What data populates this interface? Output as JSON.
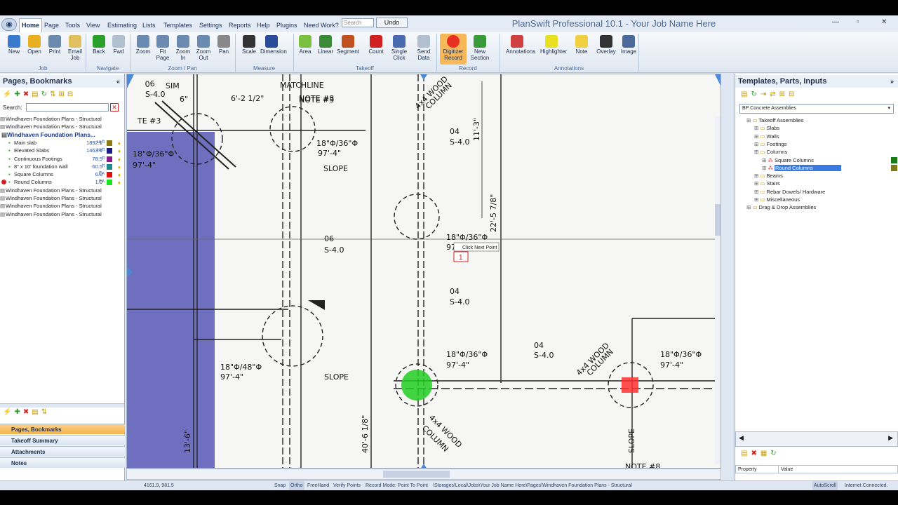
{
  "window": {
    "title": "PlanSwift Professional 10.1 - Your Job Name Here"
  },
  "menu": [
    "Home",
    "Page",
    "Tools",
    "View",
    "Estimating",
    "Lists",
    "Templates",
    "Settings",
    "Reports",
    "Help",
    "Plugins",
    "Need Work?"
  ],
  "search_placeholder": "Search",
  "undo_label": "Undo",
  "ribbon": {
    "buttons": [
      {
        "label": "New",
        "icon": "new-icon"
      },
      {
        "label": "Open",
        "icon": "open-folder-icon"
      },
      {
        "label": "Print",
        "icon": "printer-icon"
      },
      {
        "label": "Email\nJob",
        "icon": "email-icon"
      },
      {
        "label": "Back",
        "icon": "back-arrow-icon"
      },
      {
        "label": "Fwd",
        "icon": "forward-arrow-icon"
      },
      {
        "label": "Zoom",
        "icon": "zoom-icon"
      },
      {
        "label": "Fit\nPage",
        "icon": "fit-page-icon"
      },
      {
        "label": "Zoom\nIn",
        "icon": "zoom-in-icon"
      },
      {
        "label": "Zoom\nOut",
        "icon": "zoom-out-icon"
      },
      {
        "label": "Pan",
        "icon": "hand-icon"
      },
      {
        "label": "Scale",
        "icon": "scale-icon"
      },
      {
        "label": "Dimension",
        "icon": "dimension-icon"
      },
      {
        "label": "Area",
        "icon": "area-icon"
      },
      {
        "label": "Linear",
        "icon": "linear-icon"
      },
      {
        "label": "Segment",
        "icon": "segment-icon"
      },
      {
        "label": "Count",
        "icon": "count-icon"
      },
      {
        "label": "Single\nClick",
        "icon": "single-click-icon"
      },
      {
        "label": "Send\nData",
        "icon": "send-data-icon"
      },
      {
        "label": "Digitizer\nRecord",
        "icon": "record-icon"
      },
      {
        "label": "New\nSection",
        "icon": "new-section-icon"
      },
      {
        "label": "Annotations",
        "icon": "annotations-icon"
      },
      {
        "label": "Highlighter",
        "icon": "highlighter-icon"
      },
      {
        "label": "Note",
        "icon": "note-icon"
      },
      {
        "label": "Overlay",
        "icon": "overlay-icon"
      },
      {
        "label": "Image",
        "icon": "image-icon"
      }
    ],
    "groups": [
      "Job",
      "Navigate",
      "Zoom / Pan",
      "Measure",
      "Takeoff",
      "Record",
      "Annotations"
    ]
  },
  "left_panel": {
    "title": "Pages, Bookmarks",
    "search_label": "Search:",
    "rows": [
      {
        "label": "Windhaven Foundation Plans - Structural"
      },
      {
        "label": "Windhaven Foundation Plans - Structural"
      },
      {
        "label": "Windhaven Foundation Plans..."
      },
      {
        "label": "Main slab",
        "value": "1892.1",
        "unit": "sq ft",
        "color": "#8a7a10"
      },
      {
        "label": "Elevated Slabs",
        "value": "1463.4",
        "unit": "sq ft",
        "color": "#1a1a8a"
      },
      {
        "label": "Continuous Footings",
        "value": "78.5",
        "unit": "ft",
        "color": "#8a1a8a"
      },
      {
        "label": "8\" x 10' foundation wall",
        "value": "60.5",
        "unit": "ft",
        "color": "#1a8a8a"
      },
      {
        "label": "Square Columns",
        "value": "6.0",
        "unit": "EA",
        "color": "#e01010"
      },
      {
        "label": "Round Columns",
        "value": "1.0",
        "unit": "EA",
        "color": "#20e020"
      },
      {
        "label": "Windhaven Foundation Plans - Structural"
      },
      {
        "label": "Windhaven Foundation Plans - Structural"
      },
      {
        "label": "Windhaven Foundation Plans - Structural"
      },
      {
        "label": "Windhaven Foundation Plans - Structural"
      }
    ],
    "nav_tabs": [
      "Pages, Bookmarks",
      "Takeoff Summary",
      "Attachments",
      "Notes"
    ]
  },
  "drawing": {
    "labels": [
      "06",
      "S-4.0",
      "SIM",
      "MATCHLINE",
      "NOTE #8",
      "6'-2 1/2\"",
      "6\"",
      "4x4 WOOD",
      "COLUMN",
      "04",
      "S-4.0",
      "11'-3\"",
      "18\"Φ/36\"Φ",
      "97'-4\"",
      "SLOPE",
      "06",
      "S-4.0",
      "22'-5 7/8\"",
      "18\"Φ/36\"Φ",
      "97'-4\"",
      "04",
      "S-4.0",
      "18\"Φ/48\"Φ",
      "97'-4\"",
      "SLOPE",
      "13'-6\"",
      "40'-6 1/8\"",
      "18\"Φ/36\"Φ",
      "97'-4\"",
      "4x4 WOOD",
      "COLUMN",
      "04",
      "S-4.0",
      "18\"Φ/36\"Φ",
      "97'-4\"",
      "4x4 WOOD",
      "COLUMN",
      "SLOPE",
      "NOTE #3",
      "TE #3",
      "18\"Φ/36\"Φ",
      "97'-4\"",
      "NOTE #8"
    ],
    "tooltip": "Click Next Point",
    "point_badge": "1"
  },
  "right_panel": {
    "title": "Templates, Parts, Inputs",
    "dropdown": "BP Concrete Assemblies",
    "tree": [
      {
        "label": "Takeoff Assemblies",
        "level": 0
      },
      {
        "label": "Slabs",
        "level": 1
      },
      {
        "label": "Walls",
        "level": 1
      },
      {
        "label": "Footings",
        "level": 1
      },
      {
        "label": "Columns",
        "level": 1
      },
      {
        "label": "Square Columns",
        "level": 2,
        "color": "#1a7a1a"
      },
      {
        "label": "Round Columns",
        "level": 2,
        "color": "#7a7a1a",
        "selected": true
      },
      {
        "label": "Beams",
        "level": 1
      },
      {
        "label": "Stairs",
        "level": 1
      },
      {
        "label": "Rebar Dowels/ Hardware",
        "level": 1
      },
      {
        "label": "Miscellaneous",
        "level": 1
      },
      {
        "label": "Drag & Drop Assemblies",
        "level": 0
      }
    ],
    "prop_headers": [
      "Property",
      "Value"
    ]
  },
  "status": {
    "coords": "4161.9, 981.5",
    "items": [
      "Snap",
      "Ortho",
      "FreeHand",
      "Verify Points",
      "Record Mode: Point To Point"
    ],
    "path": "\\Storages\\Local\\Jobs\\Your Job Name Here\\Pages\\Windhaven Foundation Plans - Structural",
    "autoscroll": "AutoScroll",
    "connection": "Internet Connected."
  }
}
